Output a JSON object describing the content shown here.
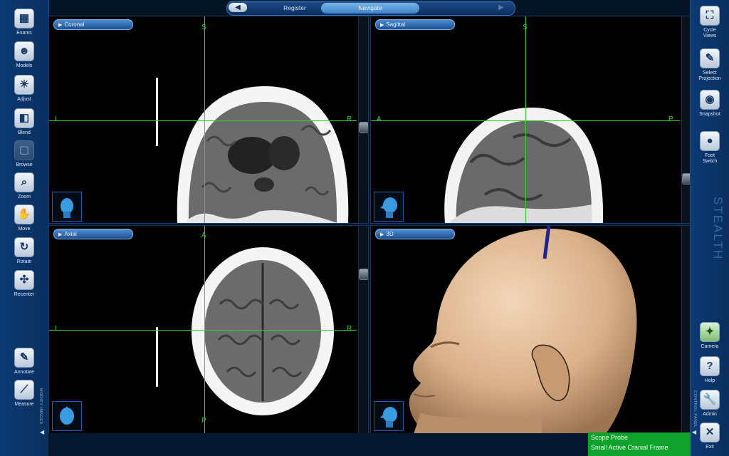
{
  "nav": {
    "register": "Register",
    "navigate": "Navigate",
    "back_icon": "◀",
    "fwd_icon": "▶"
  },
  "left_tools": [
    {
      "label": "Exams",
      "icon": "▦"
    },
    {
      "label": "Models",
      "icon": "☻"
    },
    {
      "label": "Adjust",
      "icon": "☀"
    },
    {
      "label": "Blend",
      "icon": "◧"
    },
    {
      "label": "Browse",
      "icon": "▢"
    },
    {
      "label": "Zoom",
      "icon": "⌕"
    },
    {
      "label": "Move",
      "icon": "✋"
    },
    {
      "label": "Rotate",
      "icon": "↻"
    },
    {
      "label": "Recenter",
      "icon": "✣"
    },
    {
      "label": "Annotate",
      "icon": "✎"
    },
    {
      "label": "Measure",
      "icon": "⟋"
    }
  ],
  "right_tools": [
    {
      "label": "Cycle\nViews",
      "icon": "⛶"
    },
    {
      "label": "Select\nProjection",
      "icon": "✎"
    },
    {
      "label": "Snapshot",
      "icon": "◉"
    },
    {
      "label": "Foot\nSwitch",
      "icon": "●"
    },
    {
      "label": "Camera",
      "icon": "✦"
    },
    {
      "label": "Help",
      "icon": "?"
    },
    {
      "label": "Admin",
      "icon": "🔧"
    },
    {
      "label": "Exit",
      "icon": "✕"
    }
  ],
  "left_vertical": "MODIFY IMAGES",
  "right_vertical": "CONTROL PANEL",
  "brand": "STEALTH",
  "views": {
    "coronal": {
      "label": "Coronal",
      "top": "S",
      "left": "L",
      "right": "R"
    },
    "sagittal": {
      "label": "Sagittal",
      "top": "S",
      "left": "A",
      "right": "P"
    },
    "axial": {
      "label": "Axial",
      "top": "A",
      "left": "L",
      "right": "R",
      "bottom": "P"
    },
    "threed": {
      "label": "3D"
    }
  },
  "status": {
    "line1": "Scope Probe",
    "line2": "Small Active Cranial Frame"
  }
}
